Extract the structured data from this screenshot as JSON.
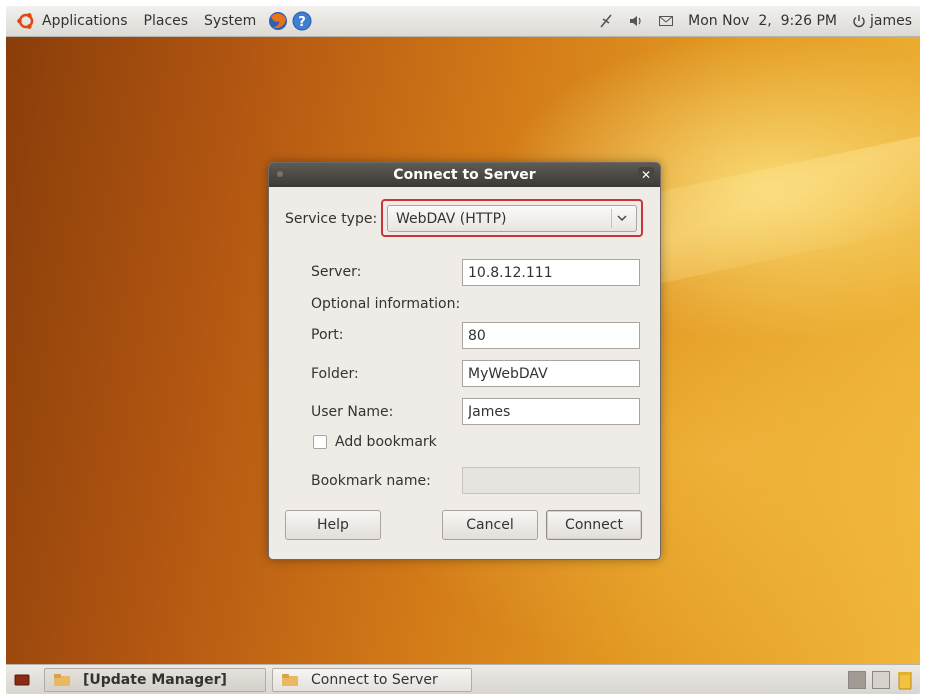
{
  "top_panel": {
    "menus": {
      "applications": "Applications",
      "places": "Places",
      "system": "System"
    },
    "clock": "Mon Nov  2,  9:26 PM",
    "user": "james",
    "icons": [
      "ubuntu-logo-icon",
      "firefox-icon",
      "help-icon",
      "network-icon",
      "volume-icon",
      "mail-icon",
      "power-icon"
    ]
  },
  "dialog": {
    "title": "Connect to Server",
    "service_type_label": "Service type:",
    "service_type_value": "WebDAV (HTTP)",
    "server_label": "Server:",
    "server_value": "10.8.12.111",
    "optional_label": "Optional information:",
    "port_label": "Port:",
    "port_value": "80",
    "folder_label": "Folder:",
    "folder_value": "MyWebDAV",
    "username_label": "User Name:",
    "username_value": "James",
    "add_bookmark_label": "Add bookmark",
    "add_bookmark_checked": false,
    "bookmark_name_label": "Bookmark name:",
    "bookmark_name_value": "",
    "buttons": {
      "help": "Help",
      "cancel": "Cancel",
      "connect": "Connect"
    },
    "highlight_color": "#c8343a"
  },
  "bottom_panel": {
    "tasks": [
      {
        "label": "[Update Manager]",
        "active": true
      },
      {
        "label": "Connect to Server",
        "active": false
      }
    ]
  }
}
